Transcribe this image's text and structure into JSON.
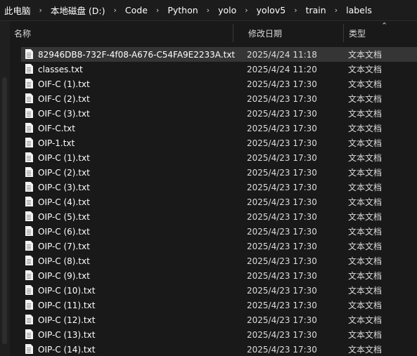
{
  "breadcrumb": [
    "此电脑",
    "本地磁盘 (D:)",
    "Code",
    "Python",
    "yolo",
    "yolov5",
    "train",
    "labels"
  ],
  "columns": {
    "name": "名称",
    "date": "修改日期",
    "type": "类型"
  },
  "icons": {
    "separator": "chevron-right-icon",
    "sort": "sort-up-icon",
    "file": "text-file-icon"
  },
  "files": [
    {
      "name": "82946DB8-732F-4f08-A676-C54FA9E2233A.txt",
      "date": "2025/4/24 11:18",
      "type": "文本文档",
      "selected": true
    },
    {
      "name": "classes.txt",
      "date": "2025/4/24 11:20",
      "type": "文本文档"
    },
    {
      "name": "OIF-C (1).txt",
      "date": "2025/4/23 17:30",
      "type": "文本文档"
    },
    {
      "name": "OIF-C (2).txt",
      "date": "2025/4/23 17:30",
      "type": "文本文档"
    },
    {
      "name": "OIF-C (3).txt",
      "date": "2025/4/23 17:30",
      "type": "文本文档"
    },
    {
      "name": "OIF-C.txt",
      "date": "2025/4/23 17:30",
      "type": "文本文档"
    },
    {
      "name": "OIP-1.txt",
      "date": "2025/4/23 17:30",
      "type": "文本文档"
    },
    {
      "name": "OIP-C (1).txt",
      "date": "2025/4/23 17:30",
      "type": "文本文档"
    },
    {
      "name": "OIP-C (2).txt",
      "date": "2025/4/23 17:30",
      "type": "文本文档"
    },
    {
      "name": "OIP-C (3).txt",
      "date": "2025/4/23 17:30",
      "type": "文本文档"
    },
    {
      "name": "OIP-C (4).txt",
      "date": "2025/4/23 17:30",
      "type": "文本文档"
    },
    {
      "name": "OIP-C (5).txt",
      "date": "2025/4/23 17:30",
      "type": "文本文档"
    },
    {
      "name": "OIP-C (6).txt",
      "date": "2025/4/23 17:30",
      "type": "文本文档"
    },
    {
      "name": "OIP-C (7).txt",
      "date": "2025/4/23 17:30",
      "type": "文本文档"
    },
    {
      "name": "OIP-C (8).txt",
      "date": "2025/4/23 17:30",
      "type": "文本文档"
    },
    {
      "name": "OIP-C (9).txt",
      "date": "2025/4/23 17:30",
      "type": "文本文档"
    },
    {
      "name": "OIP-C (10).txt",
      "date": "2025/4/23 17:30",
      "type": "文本文档"
    },
    {
      "name": "OIP-C (11).txt",
      "date": "2025/4/23 17:30",
      "type": "文本文档"
    },
    {
      "name": "OIP-C (12).txt",
      "date": "2025/4/23 17:30",
      "type": "文本文档"
    },
    {
      "name": "OIP-C (13).txt",
      "date": "2025/4/23 17:30",
      "type": "文本文档"
    },
    {
      "name": "OIP-C (14).txt",
      "date": "2025/4/23 17:30",
      "type": "文本文档"
    }
  ]
}
